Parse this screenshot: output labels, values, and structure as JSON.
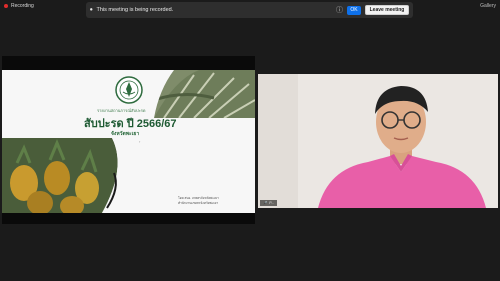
{
  "top": {
    "recording_label": "Recording",
    "right_label": "Gallery"
  },
  "banner": {
    "text": "This meeting is being recorded.",
    "ok_label": "OK",
    "leave_label": "Leave meeting",
    "accent": "#0e71eb"
  },
  "slide": {
    "subtitle": "รายงานสถานการณ์สับปะรด",
    "title": "สับปะรด ปี 2566/67",
    "province": "จังหวัดพะเยา",
    "footer_line1": "โดย สนง. เกษตรจังหวัดพะเยา",
    "footer_line2": "สำนักงานเกษตรจังหวัดพะเยา"
  },
  "video": {
    "participant_name": "P...",
    "shirt_color": "#e85fa8"
  }
}
